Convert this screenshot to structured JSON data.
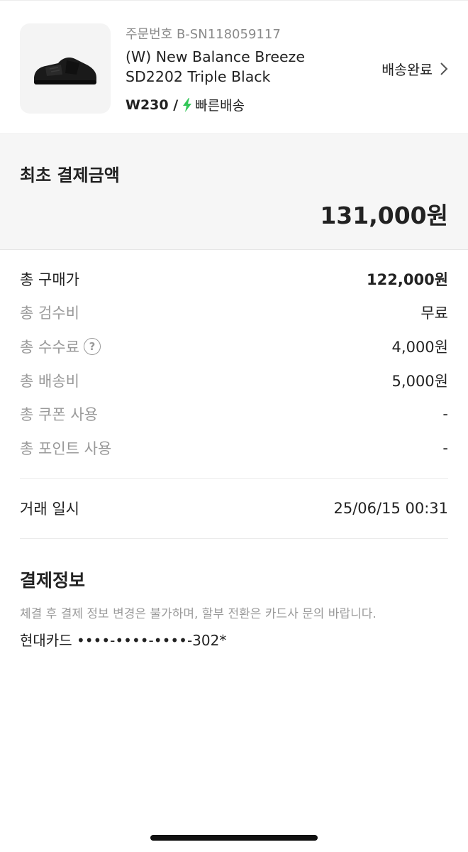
{
  "order": {
    "order_number": "주문번호 B-SN118059117",
    "product_name_line1": "(W) New Balance Breeze",
    "product_name_line2": "SD2202 Triple Black",
    "size": "W230 /",
    "delivery_type": "빠른배송",
    "status": "배송완료",
    "thumbnail_icon": "shoe-image",
    "bolt_color": "#34c759"
  },
  "total": {
    "label": "최초 결제금액",
    "amount": "131,000원"
  },
  "breakdown": [
    {
      "label": "총 구매가",
      "value": "122,000원"
    },
    {
      "label": "총 검수비",
      "value": "무료"
    },
    {
      "label": "총 수수료",
      "value": "4,000원",
      "help": "?"
    },
    {
      "label": "총 배송비",
      "value": "5,000원"
    },
    {
      "label": "총 쿠폰 사용",
      "value": "-"
    },
    {
      "label": "총 포인트 사용",
      "value": "-"
    }
  ],
  "transaction": {
    "label": "거래 일시",
    "value": "25/06/15 00:31"
  },
  "payment": {
    "title": "결제정보",
    "notice": "체결 후 결제 정보 변경은 불가하며, 할부 전환은 카드사 문의 바랍니다.",
    "card": "현대카드 ••••-••••-••••-302*"
  }
}
